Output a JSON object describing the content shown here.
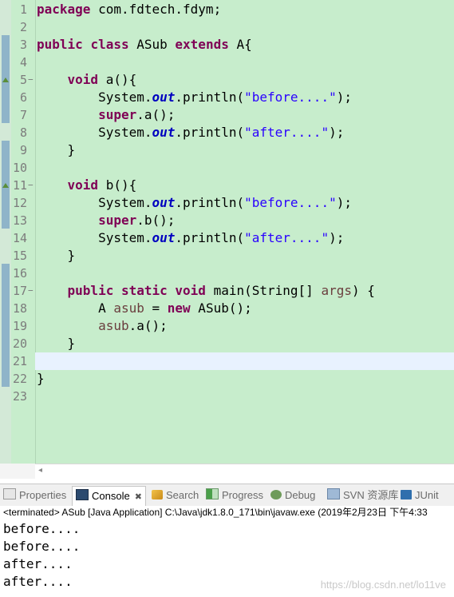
{
  "editor": {
    "line_numbers": [
      "1",
      "2",
      "3",
      "4",
      "5",
      "6",
      "7",
      "8",
      "9",
      "10",
      "11",
      "12",
      "13",
      "14",
      "15",
      "16",
      "17",
      "18",
      "19",
      "20",
      "21",
      "22",
      "23"
    ],
    "lines": [
      [
        {
          "t": "package",
          "c": "kw"
        },
        {
          "t": " com.fdtech.fdym;"
        }
      ],
      [],
      [
        {
          "t": "public",
          "c": "kw"
        },
        {
          "t": " "
        },
        {
          "t": "class",
          "c": "kw"
        },
        {
          "t": " ASub "
        },
        {
          "t": "extends",
          "c": "kw"
        },
        {
          "t": " A{"
        }
      ],
      [],
      [
        {
          "t": "    "
        },
        {
          "t": "void",
          "c": "kw"
        },
        {
          "t": " a(){"
        }
      ],
      [
        {
          "t": "        System."
        },
        {
          "t": "out",
          "c": "fld"
        },
        {
          "t": ".println("
        },
        {
          "t": "\"before....\"",
          "c": "str"
        },
        {
          "t": ");"
        }
      ],
      [
        {
          "t": "        "
        },
        {
          "t": "super",
          "c": "kw"
        },
        {
          "t": ".a();"
        }
      ],
      [
        {
          "t": "        System."
        },
        {
          "t": "out",
          "c": "fld"
        },
        {
          "t": ".println("
        },
        {
          "t": "\"after....\"",
          "c": "str"
        },
        {
          "t": ");"
        }
      ],
      [
        {
          "t": "    }"
        }
      ],
      [],
      [
        {
          "t": "    "
        },
        {
          "t": "void",
          "c": "kw"
        },
        {
          "t": " b(){"
        }
      ],
      [
        {
          "t": "        System."
        },
        {
          "t": "out",
          "c": "fld"
        },
        {
          "t": ".println("
        },
        {
          "t": "\"before....\"",
          "c": "str"
        },
        {
          "t": ");"
        }
      ],
      [
        {
          "t": "        "
        },
        {
          "t": "super",
          "c": "kw"
        },
        {
          "t": ".b();"
        }
      ],
      [
        {
          "t": "        System."
        },
        {
          "t": "out",
          "c": "fld"
        },
        {
          "t": ".println("
        },
        {
          "t": "\"after....\"",
          "c": "str"
        },
        {
          "t": ");"
        }
      ],
      [
        {
          "t": "    }"
        }
      ],
      [],
      [
        {
          "t": "    "
        },
        {
          "t": "public",
          "c": "kw"
        },
        {
          "t": " "
        },
        {
          "t": "static",
          "c": "kw"
        },
        {
          "t": " "
        },
        {
          "t": "void",
          "c": "kw"
        },
        {
          "t": " main(String[] "
        },
        {
          "t": "args",
          "c": "var"
        },
        {
          "t": ") {"
        }
      ],
      [
        {
          "t": "        A "
        },
        {
          "t": "asub",
          "c": "var"
        },
        {
          "t": " = "
        },
        {
          "t": "new",
          "c": "kw"
        },
        {
          "t": " ASub();"
        }
      ],
      [
        {
          "t": "        "
        },
        {
          "t": "asub",
          "c": "var"
        },
        {
          "t": ".a();"
        }
      ],
      [
        {
          "t": "    }"
        }
      ],
      [],
      [
        {
          "t": "}"
        }
      ],
      []
    ],
    "folds": {
      "5": "−",
      "11": "−",
      "17": "−"
    },
    "override_markers": [
      "5",
      "11"
    ],
    "current_line": "21"
  },
  "tabs": [
    {
      "label": "Properties",
      "icon": "properties-icon",
      "active": false
    },
    {
      "label": "Console",
      "icon": "console-icon",
      "active": true,
      "close": "✖"
    },
    {
      "label": "Search",
      "icon": "search-icon",
      "active": false
    },
    {
      "label": "Progress",
      "icon": "progress-icon",
      "active": false
    },
    {
      "label": "Debug",
      "icon": "debug-icon",
      "active": false
    },
    {
      "label": "SVN 资源库",
      "icon": "svn-icon",
      "active": false
    },
    {
      "label": "JUnit",
      "icon": "junit-icon",
      "active": false
    }
  ],
  "console": {
    "header": "<terminated> ASub [Java Application] C:\\Java\\jdk1.8.0_171\\bin\\javaw.exe (2019年2月23日 下午4:33",
    "output": [
      "before....",
      "before....",
      "after....",
      "after...."
    ],
    "watermark": "https://blog.csdn.net/lo11ve"
  }
}
